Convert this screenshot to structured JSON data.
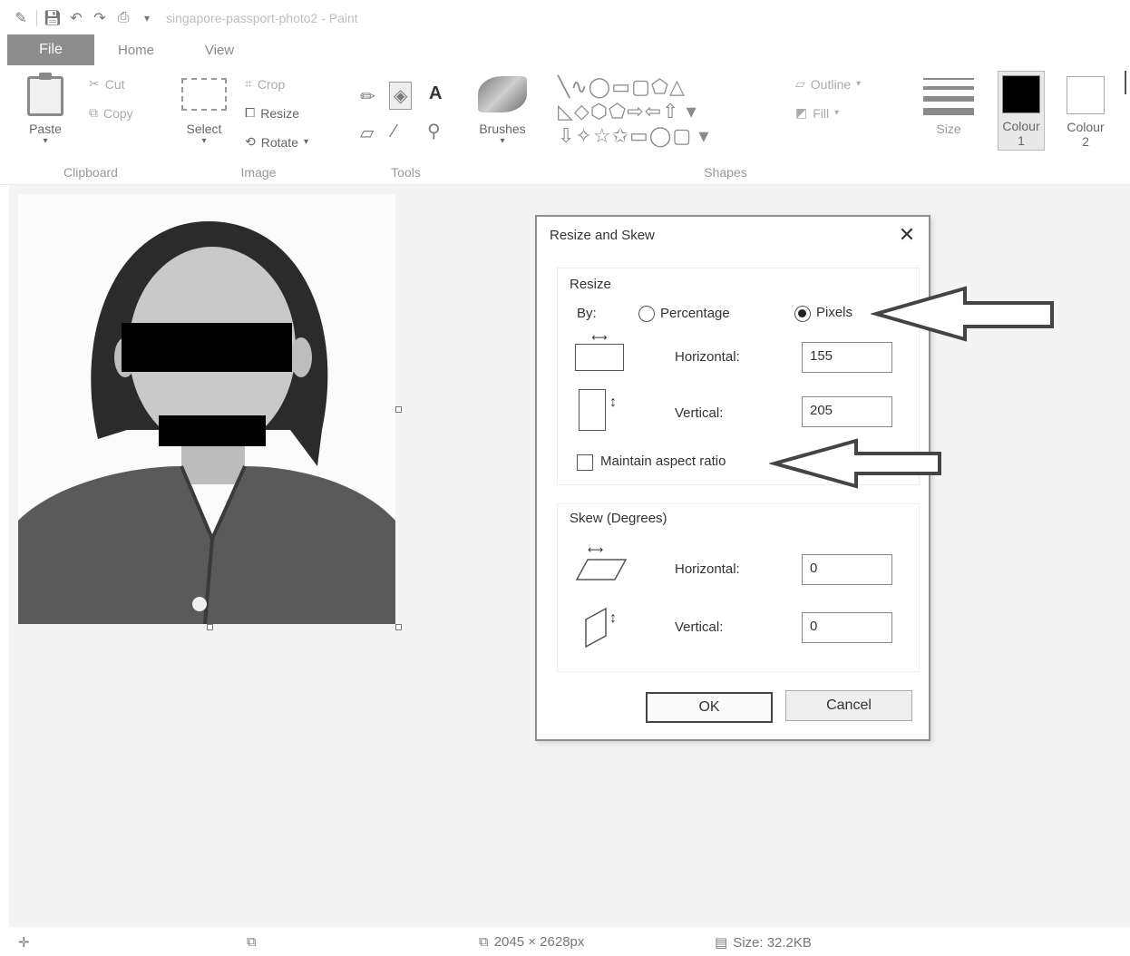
{
  "window": {
    "title": "singapore-passport-photo2 - Paint"
  },
  "tabs": {
    "file": "File",
    "home": "Home",
    "view": "View"
  },
  "ribbon": {
    "clipboard": {
      "paste": "Paste",
      "cut": "Cut",
      "copy": "Copy",
      "label": "Clipboard"
    },
    "image": {
      "select": "Select",
      "crop": "Crop",
      "resize": "Resize",
      "rotate": "Rotate",
      "label": "Image"
    },
    "tools": {
      "label": "Tools",
      "text_tool": "A"
    },
    "brushes": {
      "label": "Brushes"
    },
    "shapes": {
      "label": "Shapes",
      "outline": "Outline",
      "fill": "Fill"
    },
    "size": {
      "label": "Size"
    },
    "colour1": {
      "label": "Colour",
      "index": "1",
      "color": "#000000"
    },
    "colour2": {
      "label": "Colour",
      "index": "2",
      "color": "#ffffff"
    }
  },
  "dialog": {
    "title": "Resize and Skew",
    "resize": {
      "heading": "Resize",
      "by_label": "By:",
      "percentage_label": "Percentage",
      "pixels_label": "Pixels",
      "selected": "Pixels",
      "horizontal_label": "Horizontal:",
      "horizontal_value": "155",
      "vertical_label": "Vertical:",
      "vertical_value": "205",
      "maintain_aspect_label": "Maintain aspect ratio",
      "maintain_aspect_checked": false
    },
    "skew": {
      "heading": "Skew (Degrees)",
      "horizontal_label": "Horizontal:",
      "horizontal_value": "0",
      "vertical_label": "Vertical:",
      "vertical_value": "0"
    },
    "ok_label": "OK",
    "cancel_label": "Cancel"
  },
  "statusbar": {
    "dimensions": "2045 × 2628px",
    "size": "Size: 32.2KB"
  }
}
